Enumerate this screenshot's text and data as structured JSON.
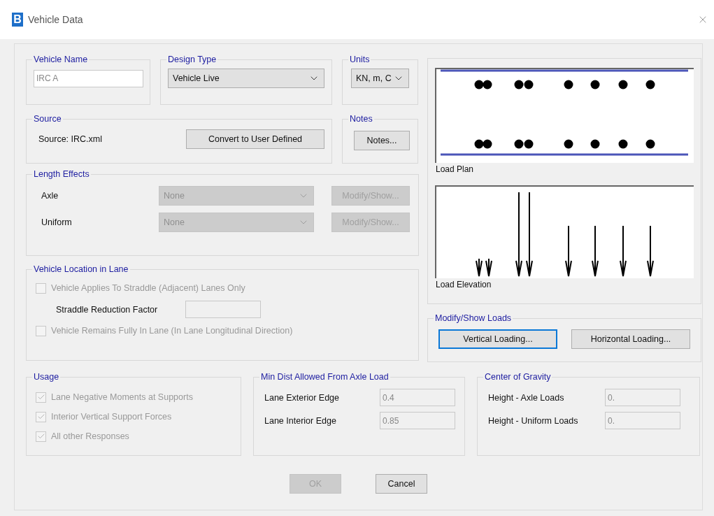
{
  "window": {
    "title": "Vehicle Data",
    "icon_letter": "B"
  },
  "vehicle_name": {
    "label": "Vehicle Name",
    "value": "IRC A"
  },
  "design_type": {
    "label": "Design Type",
    "value": "Vehicle Live"
  },
  "units": {
    "label": "Units",
    "value": "KN, m, C"
  },
  "source": {
    "label": "Source",
    "text": "Source: IRC.xml",
    "button": "Convert to User Defined"
  },
  "notes": {
    "label": "Notes",
    "button": "Notes..."
  },
  "length_effects": {
    "label": "Length Effects",
    "rows": [
      {
        "label": "Axle",
        "value": "None",
        "button": "Modify/Show...",
        "disabled": true
      },
      {
        "label": "Uniform",
        "value": "None",
        "button": "Modify/Show...",
        "disabled": true
      }
    ]
  },
  "vehicle_location": {
    "label": "Vehicle Location in Lane",
    "items": [
      {
        "kind": "checkbox",
        "label": "Vehicle Applies To Straddle (Adjacent) Lanes Only",
        "checked": false,
        "disabled": true
      },
      {
        "kind": "field",
        "label": "Straddle Reduction Factor",
        "disabled": true
      },
      {
        "kind": "checkbox",
        "label": "Vehicle Remains Fully In Lane (In Lane Longitudinal Direction)",
        "checked": false,
        "disabled": true
      }
    ]
  },
  "diagrams": {
    "plan_caption": "Load Plan",
    "elevation_caption": "Load Elevation"
  },
  "loads": {
    "label": "Modify/Show Loads",
    "buttons": [
      {
        "label": "Vertical Loading...",
        "focused": true
      },
      {
        "label": "Horizontal Loading...",
        "focused": false
      }
    ]
  },
  "usage": {
    "label": "Usage",
    "items": [
      {
        "label": "Lane Negative Moments at Supports",
        "checked": true,
        "disabled": true
      },
      {
        "label": "Interior Vertical Support Forces",
        "checked": true,
        "disabled": true
      },
      {
        "label": "All other Responses",
        "checked": true,
        "disabled": true
      }
    ]
  },
  "min_dist": {
    "label": "Min Dist Allowed From Axle Load",
    "rows": [
      {
        "label": "Lane Exterior Edge",
        "value": "0.4"
      },
      {
        "label": "Lane Interior Edge",
        "value": "0.85"
      }
    ]
  },
  "center_of_gravity": {
    "label": "Center of Gravity",
    "rows": [
      {
        "label": "Height - Axle Loads",
        "value": "0."
      },
      {
        "label": "Height - Uniform Loads",
        "value": "0."
      }
    ]
  },
  "buttons": [
    {
      "label": "OK",
      "disabled": true
    },
    {
      "label": "Cancel",
      "disabled": false
    }
  ]
}
